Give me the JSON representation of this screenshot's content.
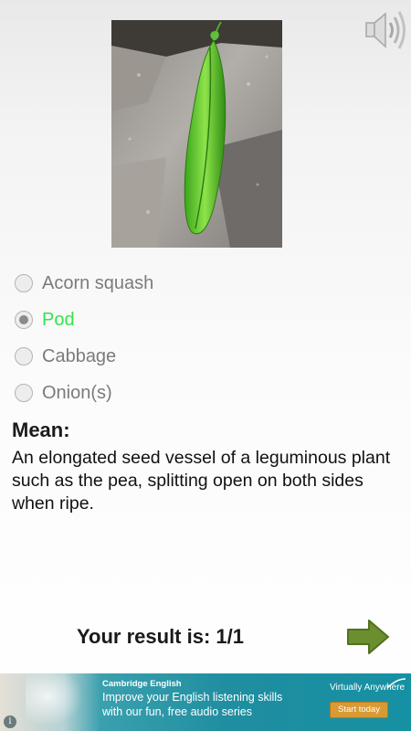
{
  "image": {
    "subject": "pea-pod-on-rock"
  },
  "audio": {
    "icon": "speaker-icon"
  },
  "quiz": {
    "options": [
      {
        "label": "Acorn squash",
        "selected": false,
        "correct": false
      },
      {
        "label": "Pod",
        "selected": true,
        "correct": true
      },
      {
        "label": "Cabbage",
        "selected": false,
        "correct": false
      },
      {
        "label": "Onion(s)",
        "selected": false,
        "correct": false
      }
    ],
    "correct_color": "#34e34a",
    "mean_title": "Mean:",
    "mean_text": "An elongated seed vessel of a leguminous plant such as the pea, splitting open on both sides when ripe.",
    "result": "Your result is: 1/1",
    "next_icon": "arrow-right-icon",
    "next_color": "#6b8f2e"
  },
  "ad": {
    "brand": "Cambridge English",
    "line1": "Improve your English listening skills",
    "line2": "with our fun, free audio series",
    "sponsor": "Virtually Anywhere",
    "cta": "Start today",
    "info_icon": "info-icon",
    "bg_color": "#1690a3"
  }
}
